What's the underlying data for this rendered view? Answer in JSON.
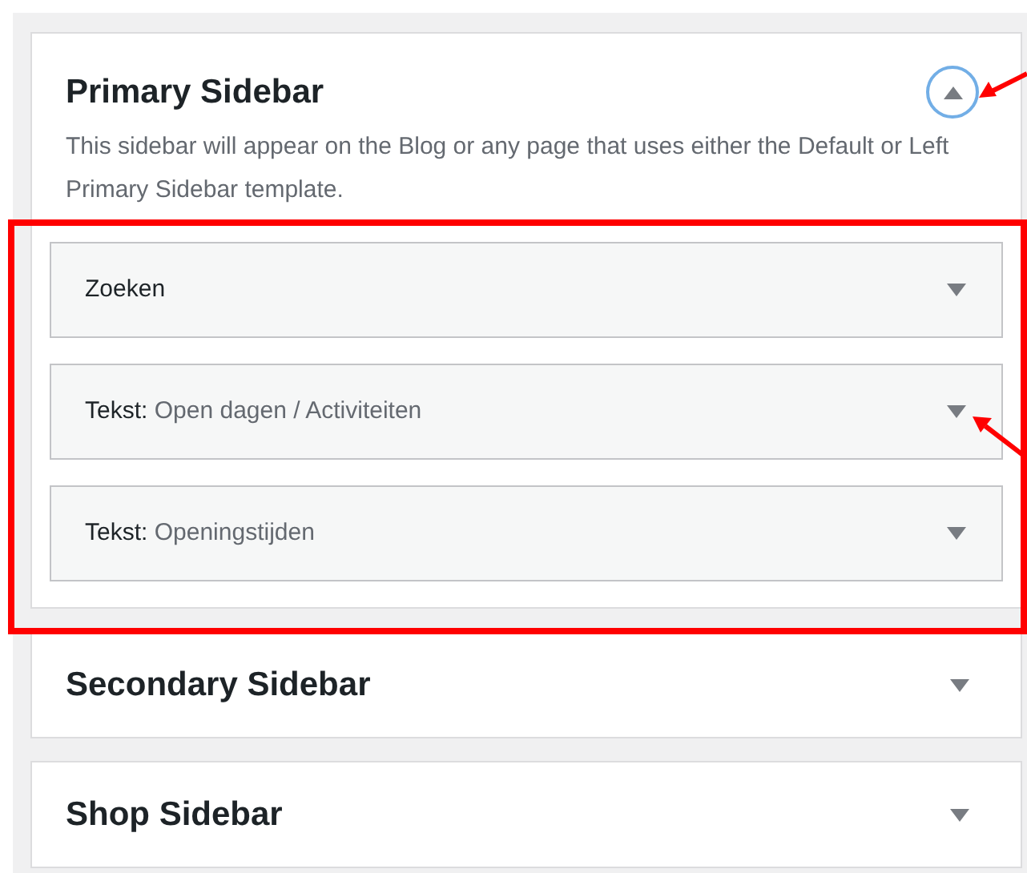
{
  "sidebars": [
    {
      "title": "Primary Sidebar",
      "expanded": true,
      "description": "This sidebar will appear on the Blog or any page that uses either the Default or Left Primary Sidebar template.",
      "widgets": [
        {
          "label": "Zoeken"
        },
        {
          "label": "Tekst:",
          "title": "Open dagen / Activiteiten"
        },
        {
          "label": "Tekst:",
          "title": "Openingstijden"
        }
      ]
    },
    {
      "title": "Secondary Sidebar",
      "expanded": false
    },
    {
      "title": "Shop Sidebar",
      "expanded": false
    }
  ]
}
